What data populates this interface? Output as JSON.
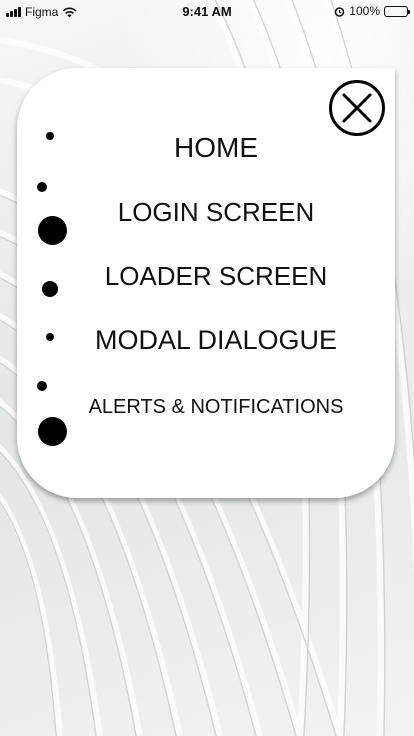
{
  "status_bar": {
    "carrier": "Figma",
    "time": "9:41 AM",
    "battery": "100%"
  },
  "menu": {
    "close_icon": "close-icon",
    "items": [
      {
        "label": "HOME"
      },
      {
        "label": "LOGIN SCREEN"
      },
      {
        "label": "LOADER SCREEN"
      },
      {
        "label": "MODAL DIALOGUE"
      },
      {
        "label": "ALERTS & NOTIFICATIONS"
      }
    ]
  },
  "colors": {
    "card": "#ffffff",
    "text": "#111111",
    "background": "#ecefef"
  }
}
